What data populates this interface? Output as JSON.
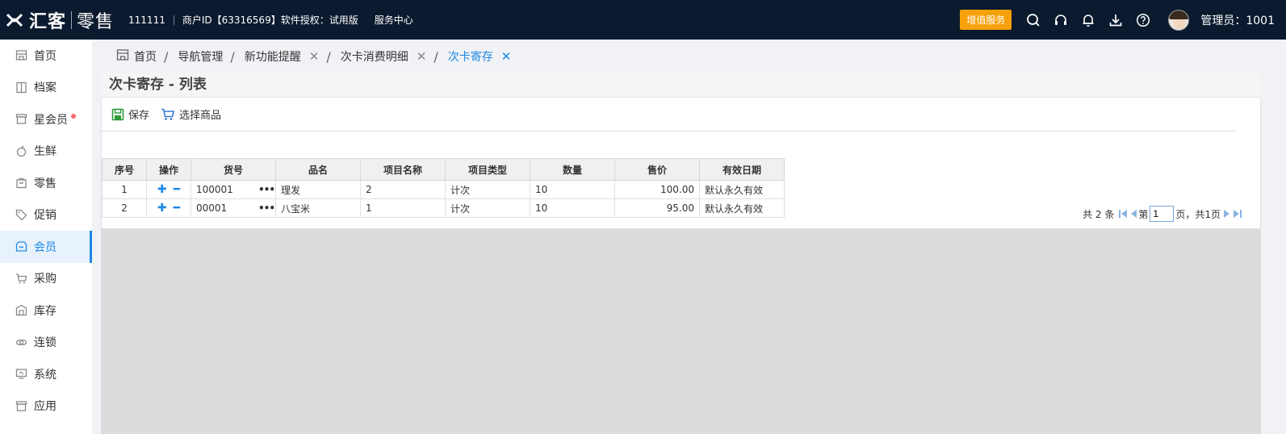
{
  "header": {
    "logo_main": "汇客",
    "logo_sub": "零售",
    "account": "111111",
    "merchant": "商户ID【63316569】软件授权：试用版",
    "service_center": "服务中心",
    "vas_button": "增值服务",
    "admin": "管理员：1001"
  },
  "sidebar": {
    "items": [
      {
        "label": "首页",
        "icon": "home-icon"
      },
      {
        "label": "档案",
        "icon": "archive-icon"
      },
      {
        "label": "星会员",
        "icon": "star-member-icon",
        "badge": true
      },
      {
        "label": "生鲜",
        "icon": "fresh-icon"
      },
      {
        "label": "零售",
        "icon": "retail-icon"
      },
      {
        "label": "促销",
        "icon": "tag-icon"
      },
      {
        "label": "会员",
        "icon": "member-icon",
        "active": true
      },
      {
        "label": "采购",
        "icon": "cart-icon"
      },
      {
        "label": "库存",
        "icon": "warehouse-icon"
      },
      {
        "label": "连锁",
        "icon": "chain-icon"
      },
      {
        "label": "系统",
        "icon": "monitor-icon"
      },
      {
        "label": "应用",
        "icon": "app-icon"
      }
    ]
  },
  "breadcrumb": {
    "home": "首页",
    "items": [
      "导航管理",
      "新功能提醒",
      "次卡消费明细",
      "次卡寄存"
    ],
    "active": "次卡寄存"
  },
  "panel": {
    "title": "次卡寄存 - 列表",
    "save_label": "保存",
    "select_goods_label": "选择商品"
  },
  "table": {
    "columns": [
      "序号",
      "操作",
      "货号",
      "品名",
      "项目名称",
      "项目类型",
      "数量",
      "售价",
      "有效日期"
    ],
    "rows": [
      {
        "seq": "1",
        "code": "100001",
        "name": "理发",
        "item_name": "2",
        "item_type": "计次",
        "qty": "10",
        "price": "100.00",
        "valid": "默认永久有效"
      },
      {
        "seq": "2",
        "code": "00001",
        "name": "八宝米",
        "item_name": "1",
        "item_type": "计次",
        "qty": "10",
        "price": "95.00",
        "valid": "默认永久有效"
      }
    ]
  },
  "pager": {
    "total": "共 2 条",
    "page_prefix": "第",
    "page_value": "1",
    "page_suffix": "页，共1页"
  },
  "colors": {
    "topbar": "#0b1a2e",
    "accent": "#1e88e5",
    "vas": "#f6a10a"
  }
}
